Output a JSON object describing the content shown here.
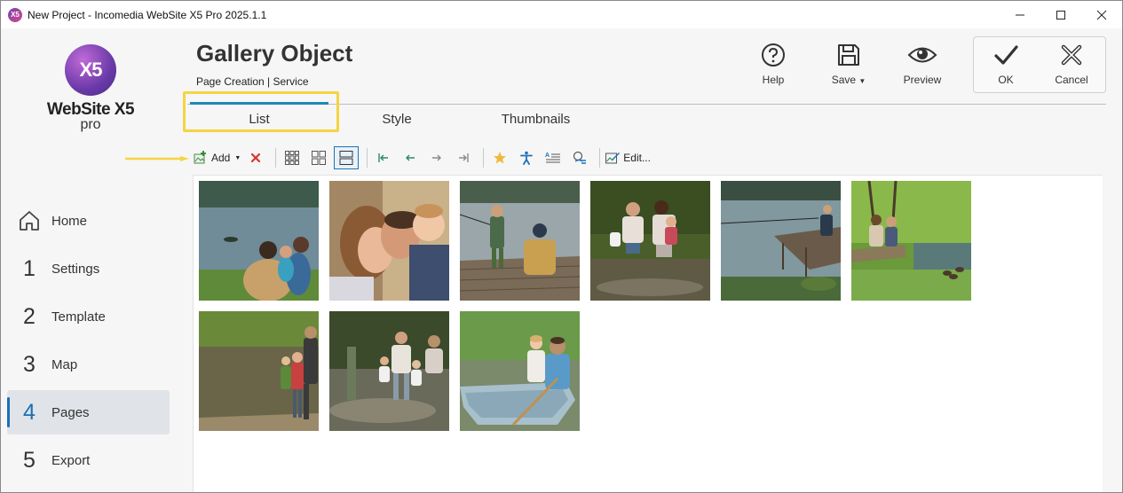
{
  "titlebar": {
    "app_icon": "X5",
    "title": "New Project - Incomedia WebSite X5 Pro 2025.1.1",
    "controls": [
      "minimize-icon",
      "maximize-icon",
      "close-icon"
    ]
  },
  "logo": {
    "mark": "X5",
    "name": "WebSite X5",
    "edition": "pro"
  },
  "nav": {
    "items": [
      {
        "number": "",
        "icon": "home-icon",
        "label": "Home"
      },
      {
        "number": "1",
        "label": "Settings"
      },
      {
        "number": "2",
        "label": "Template"
      },
      {
        "number": "3",
        "label": "Map"
      },
      {
        "number": "4",
        "label": "Pages",
        "active": true
      },
      {
        "number": "5",
        "label": "Export"
      }
    ]
  },
  "header": {
    "title": "Gallery Object",
    "breadcrumb": "Page Creation | Service",
    "buttons": {
      "help": "Help",
      "save": "Save",
      "preview": "Preview",
      "ok": "OK",
      "cancel": "Cancel"
    }
  },
  "tabs": [
    {
      "label": "List",
      "active": true
    },
    {
      "label": "Style"
    },
    {
      "label": "Thumbnails"
    }
  ],
  "toolbar": {
    "add": "Add",
    "edit": "Edit..."
  },
  "colors": {
    "accent": "#1d8ab8",
    "highlight": "#f5d442",
    "delete": "#d9342b"
  },
  "gallery": {
    "images": [
      "family-sitting-by-lake-photo",
      "mother-father-child-closeup-photo",
      "children-fishing-on-pier-photo",
      "family-in-water-photo",
      "fishing-from-pier-photo",
      "family-sitting-by-river-photo",
      "father-children-on-pier-photo",
      "family-in-lake-photo",
      "father-daughter-in-boat-photo"
    ]
  }
}
